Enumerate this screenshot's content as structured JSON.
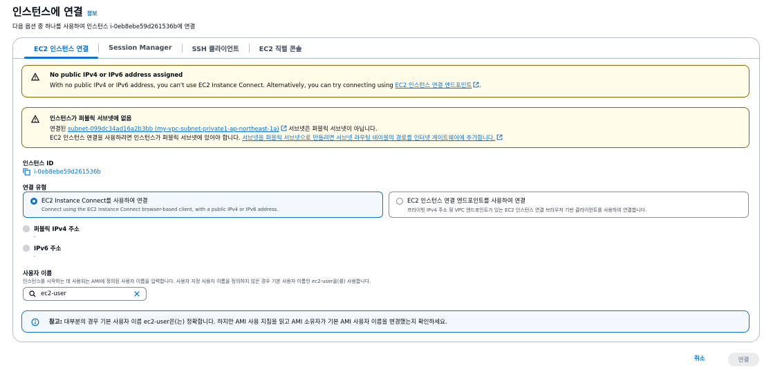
{
  "header": {
    "title": "인스턴스에 연결",
    "info": "정보",
    "subtitle": "다음 옵션 중 하나를 사용하여 인스턴스 i-0eb8ebe59d261536b에 연결"
  },
  "tabs": [
    {
      "label": "EC2 인스턴스 연결",
      "active": true
    },
    {
      "label": "Session Manager",
      "active": false
    },
    {
      "label": "SSH 클라이언트",
      "active": false
    },
    {
      "label": "EC2 직렬 콘솔",
      "active": false
    }
  ],
  "alert1": {
    "title": "No public IPv4 or IPv6 address assigned",
    "text": "With no public IPv4 or IPv6 address, you can't use EC2 Instance Connect. Alternatively, you can try connecting using ",
    "link": "EC2 인스턴스 연결 엔드포인트",
    "suffix": "."
  },
  "alert2": {
    "title": "인스턴스가 퍼블릭 서브넷에 없음",
    "line1_prefix": "연결된 ",
    "line1_link": "subnet-099dc34ad16a2b3bb (my-vpc-subnet-private1-ap-northeast-1a)",
    "line1_suffix": " 서브넷은 퍼블릭 서브넷이 아닙니다.",
    "line2_prefix": "EC2 인스턴스 연결을 사용하려면 인스턴스가 퍼블릭 서브넷에 있어야 합니다. ",
    "line2_link": "서브넷을 퍼블릭 서브넷으로 만들려면 서브넷 라우팅 테이블의 경로를 인터넷 게이트웨이에 추가합니다."
  },
  "instance": {
    "label": "인스턴스 ID",
    "id": "i-0eb8ebe59d261536b"
  },
  "connection_type": {
    "label": "연결 유형",
    "options": [
      {
        "title": "EC2 Instance Connect를 사용하여 연결",
        "desc": "Connect using the EC2 Instance Connect browser-based client, with a public IPv4 or IPv6 address.",
        "selected": true
      },
      {
        "title": "EC2 인스턴스 연결 엔드포인트를 사용하여 연결",
        "desc": "프라이빗 IPv4 주소 및 VPC 엔드포인트가 있는 EC2 인스턴스 연결 브라우저 기반 클라이언트를 사용하여 연결합니다.",
        "selected": false
      }
    ]
  },
  "public_ipv4": {
    "label": "퍼블릭 IPv4 주소",
    "value": "–"
  },
  "ipv6": {
    "label": "IPv6 주소",
    "value": "–"
  },
  "username": {
    "label": "사용자 이름",
    "desc": "인스턴스를 시작하는 데 사용되는 AMI에 정의된 사용자 이름을 입력합니다. 사용자 지정 사용자 이름을 정의하지 않은 경우 기본 사용자 이름인 ec2-user을(를) 사용합니다.",
    "value": "ec2-user"
  },
  "note": {
    "bold": "참고:",
    "text": " 대부분의 경우 기본 사용자 이름 ec2-user은(는) 정확합니다. 하지만 AMI 사용 지침을 읽고 AMI 소유자가 기본 AMI 사용자 이름을 변경했는지 확인하세요."
  },
  "footer": {
    "cancel": "취소",
    "connect": "연결"
  },
  "colors": {
    "accent": "#0972d3",
    "warning_border": "#8d6605",
    "warning_bg": "#fffce9",
    "info_bg": "#f2f8fd"
  }
}
